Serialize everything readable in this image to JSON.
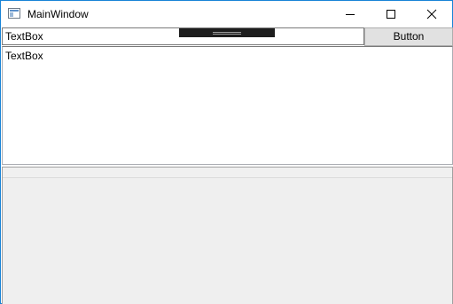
{
  "window": {
    "title": "MainWindow",
    "accent_color": "#1883d7",
    "icons": {
      "app": "app-window-icon",
      "minimize": "minimize-icon",
      "maximize": "maximize-icon",
      "close": "close-icon"
    }
  },
  "toolbar": {
    "textbox_value": "TextBox",
    "button_label": "Button",
    "grip_icon": "drag-handle-icon"
  },
  "main": {
    "textbox_value": "TextBox"
  }
}
